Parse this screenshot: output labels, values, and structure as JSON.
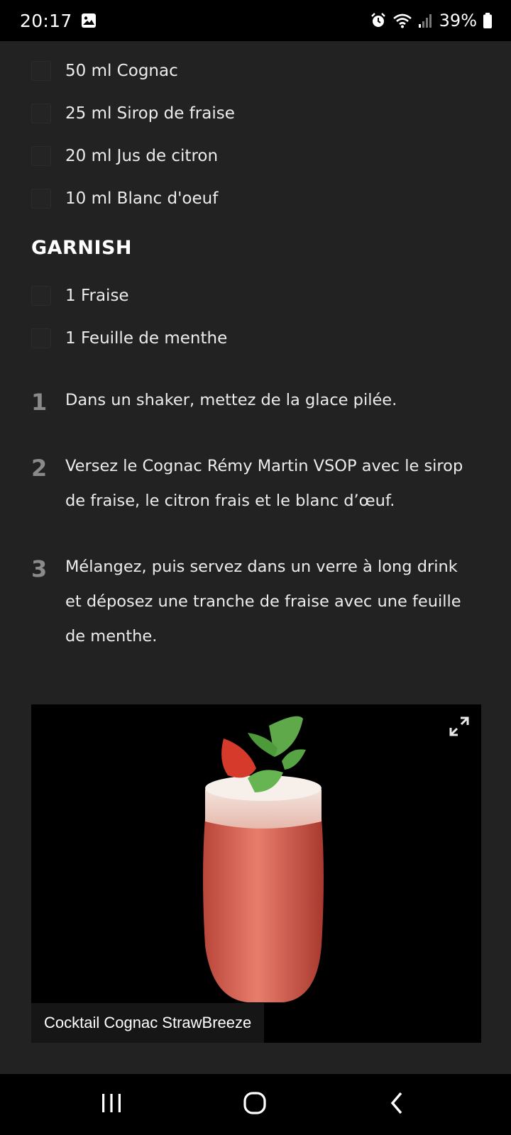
{
  "status_bar": {
    "time": "20:17",
    "battery": "39%",
    "icons": [
      "gallery-icon",
      "alarm-icon",
      "wifi-icon",
      "signal-icon",
      "battery-icon"
    ]
  },
  "ingredients": [
    {
      "label": "50 ml Cognac"
    },
    {
      "label": "25 ml Sirop de fraise"
    },
    {
      "label": "20 ml Jus de citron"
    },
    {
      "label": "10 ml Blanc d'oeuf"
    }
  ],
  "garnish": {
    "heading": "GARNISH",
    "items": [
      {
        "label": "1 Fraise"
      },
      {
        "label": "1 Feuille de menthe"
      }
    ]
  },
  "steps": [
    {
      "number": "1",
      "text": "Dans un shaker, mettez de la glace pilée."
    },
    {
      "number": "2",
      "text": "Versez le Cognac Rémy Martin VSOP avec le sirop de fraise, le citron frais et le blanc d’œuf."
    },
    {
      "number": "3",
      "text": "Mélangez, puis servez dans un verre à long drink et déposez une tranche de fraise avec une feuille de menthe."
    }
  ],
  "photo": {
    "caption": "Cocktail Cognac StrawBreeze",
    "icon": "expand-icon"
  },
  "nav_bar": {
    "icons": [
      "recents-icon",
      "home-icon",
      "back-icon"
    ]
  },
  "colors": {
    "background": "#222222",
    "text": "#ececec",
    "step_number": "#8a8a8a",
    "bars": "#000000"
  }
}
